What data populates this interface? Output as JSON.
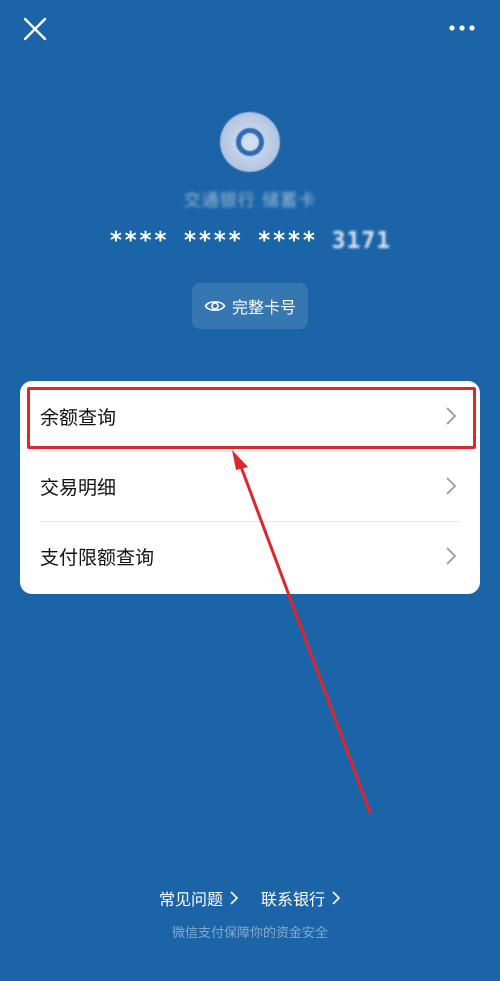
{
  "header": {
    "close_icon": "close-icon",
    "more_icon": "more-icon"
  },
  "card": {
    "bank_name": "交通银行 储蓄卡",
    "masked_number": "**** **** ****",
    "last_four": "3171",
    "full_number_button": "完整卡号",
    "eye_icon": "eye-icon"
  },
  "menu": {
    "items": [
      {
        "label": "余额查询"
      },
      {
        "label": "交易明细"
      },
      {
        "label": "支付限额查询"
      }
    ]
  },
  "footer": {
    "faq_label": "常见问题",
    "contact_bank_label": "联系银行",
    "security_note": "微信支付保障你的资金安全"
  },
  "colors": {
    "background": "#1b64a7",
    "card_bg": "#ffffff",
    "highlight": "#e0262a"
  }
}
